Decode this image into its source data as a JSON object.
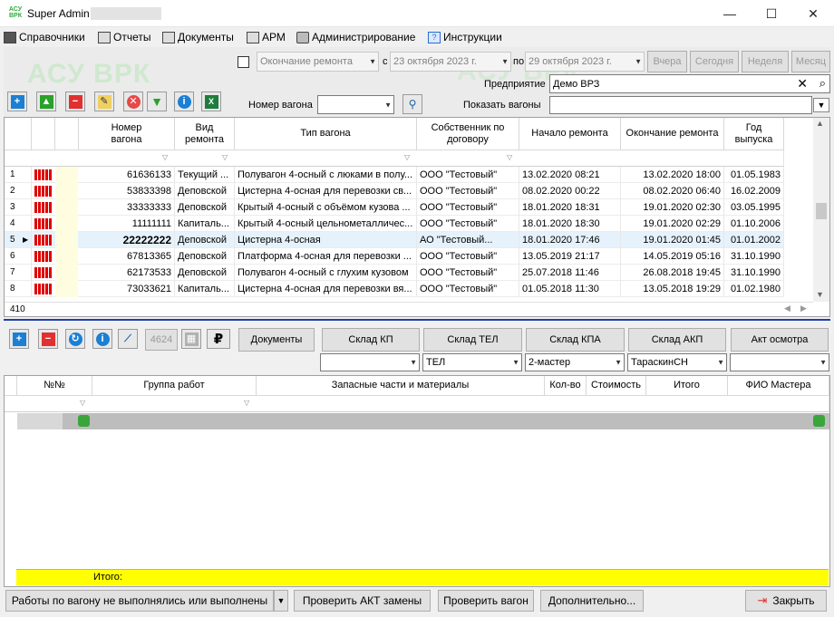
{
  "window": {
    "title": "Super Admin",
    "logo": "АСУ ВРК",
    "minimize": "—",
    "maximize": "☐",
    "close": "✕"
  },
  "menu": [
    {
      "label": "Справочники",
      "icon": "books-icon"
    },
    {
      "label": "Отчеты",
      "icon": "reports-icon"
    },
    {
      "label": "Документы",
      "icon": "documents-icon"
    },
    {
      "label": "АРМ",
      "icon": "workstation-icon"
    },
    {
      "label": "Администрирование",
      "icon": "tools-icon"
    },
    {
      "label": "Инструкции",
      "icon": "help-icon"
    }
  ],
  "watermark": "АСУ ВРК",
  "filter": {
    "period_field": "Окончание ремонта",
    "from_label": "с",
    "from_date": "23 октября  2023 г.",
    "to_label": "по",
    "to_date": "29 октября  2023 г.",
    "quick": [
      "Вчера",
      "Сегодня",
      "Неделя",
      "Месяц"
    ],
    "enterprise_label": "Предприятие",
    "enterprise_value": "Демо ВРЗ",
    "wagon_label": "Номер вагона",
    "wagon_value": "",
    "show_label": "Показать вагоны",
    "show_value": ""
  },
  "grid1": {
    "columns": [
      "Номер вагона",
      "Вид ремонта",
      "Тип вагона",
      "Собственник по договору",
      "Начало ремонта",
      "Окончание ремонта",
      "Год выпуска"
    ],
    "rows": [
      {
        "n": "1",
        "num": "61636133",
        "kind": "Текущий ...",
        "type": "Полувагон 4-осный с люками в полу...",
        "owner": "ООО \"Тестовый\"",
        "start": "13.02.2020 08:21",
        "end": "13.02.2020 18:00",
        "year": "01.05.1983"
      },
      {
        "n": "2",
        "num": "53833398",
        "kind": "Деповской",
        "type": "Цистерна 4-осная для перевозки св...",
        "owner": "ООО \"Тестовый\"",
        "start": "08.02.2020 00:22",
        "end": "08.02.2020 06:40",
        "year": "16.02.2009"
      },
      {
        "n": "3",
        "num": "33333333",
        "kind": "Деповской",
        "type": "Крытый 4-осный с объёмом кузова ...",
        "owner": "ООО \"Тестовый\"",
        "start": "18.01.2020 18:31",
        "end": "19.01.2020 02:30",
        "year": "03.05.1995"
      },
      {
        "n": "4",
        "num": "11111111",
        "kind": "Капиталь...",
        "type": "Крытый 4-осный цельнометалличес...",
        "owner": "ООО \"Тестовый\"",
        "start": "18.01.2020 18:30",
        "end": "19.01.2020 02:29",
        "year": "01.10.2006"
      },
      {
        "n": "5",
        "num": "22222222",
        "kind": "Деповской",
        "type": "Цистерна 4-осная",
        "owner": "АО \"Тестовый...",
        "start": "18.01.2020 17:46",
        "end": "19.01.2020 01:45",
        "year": "01.01.2002"
      },
      {
        "n": "6",
        "num": "67813365",
        "kind": "Деповской",
        "type": "Платформа 4-осная для перевозки ...",
        "owner": "ООО \"Тестовый\"",
        "start": "13.05.2019 21:17",
        "end": "14.05.2019 05:16",
        "year": "31.10.1990"
      },
      {
        "n": "7",
        "num": "62173533",
        "kind": "Деповской",
        "type": "Полувагон 4-осный с глухим кузовом",
        "owner": "ООО \"Тестовый\"",
        "start": "25.07.2018 11:46",
        "end": "26.08.2018 19:45",
        "year": "31.10.1990"
      },
      {
        "n": "8",
        "num": "73033621",
        "kind": "Капиталь...",
        "type": "Цистерна 4-осная для перевозки вя...",
        "owner": "ООО \"Тестовый\"",
        "start": "01.05.2018 11:30",
        "end": "13.05.2018 19:29",
        "year": "01.02.1980"
      }
    ],
    "count": "410"
  },
  "toolbar2": {
    "counter": "4624",
    "buttons": [
      "Документы",
      "Склад КП",
      "Склад ТЕЛ",
      "Склад КПА",
      "Склад АКП",
      "Акт осмотра"
    ],
    "combos": [
      "",
      "ТЕЛ",
      "2-мастер",
      "ТараскинСН",
      ""
    ]
  },
  "grid2": {
    "columns": [
      "№№",
      "Группа работ",
      "Запасные части и материалы",
      "Кол-во",
      "Стоимость",
      "Итого",
      "ФИО Мастера"
    ],
    "total_label": "Итого:"
  },
  "bottom": {
    "works": "Работы по вагону не выполнялись или выполнены",
    "check_act": "Проверить АКТ замены",
    "check_wagon": "Проверить вагон",
    "more": "Дополнительно...",
    "close": "Закрыть"
  }
}
